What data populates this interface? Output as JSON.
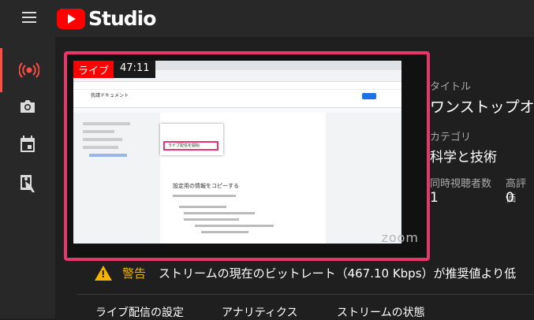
{
  "app": {
    "brand": "Studio"
  },
  "nav": {
    "items": [
      "live-icon",
      "camera-icon",
      "calendar-icon",
      "stream-icon"
    ]
  },
  "preview": {
    "live_label": "ライブ",
    "duration": "47:11",
    "watermark": "zoom",
    "doc_title": "我請ドキュメント",
    "doc_heading": "設定用の情報をコピーする",
    "popup_item": "ライブ配信を開始"
  },
  "meta": {
    "title_label": "タイトル",
    "title_value": "ワンストップオ",
    "category_label": "カテゴリ",
    "category_value": "科学と技術",
    "concurrent_label": "同時視聴者数",
    "concurrent_value": "1",
    "ratings_label": "高評価",
    "ratings_value": "0"
  },
  "warning": {
    "label": "警告",
    "text": "ストリームの現在のビットレート（467.10 Kbps）が推奨値より低"
  },
  "tabs": [
    "ライブ配信の設定",
    "アナリティクス",
    "ストリームの状態"
  ],
  "colors": {
    "accent": "#ff0000",
    "highlight": "#e8366d",
    "warning": "#f4b400"
  }
}
